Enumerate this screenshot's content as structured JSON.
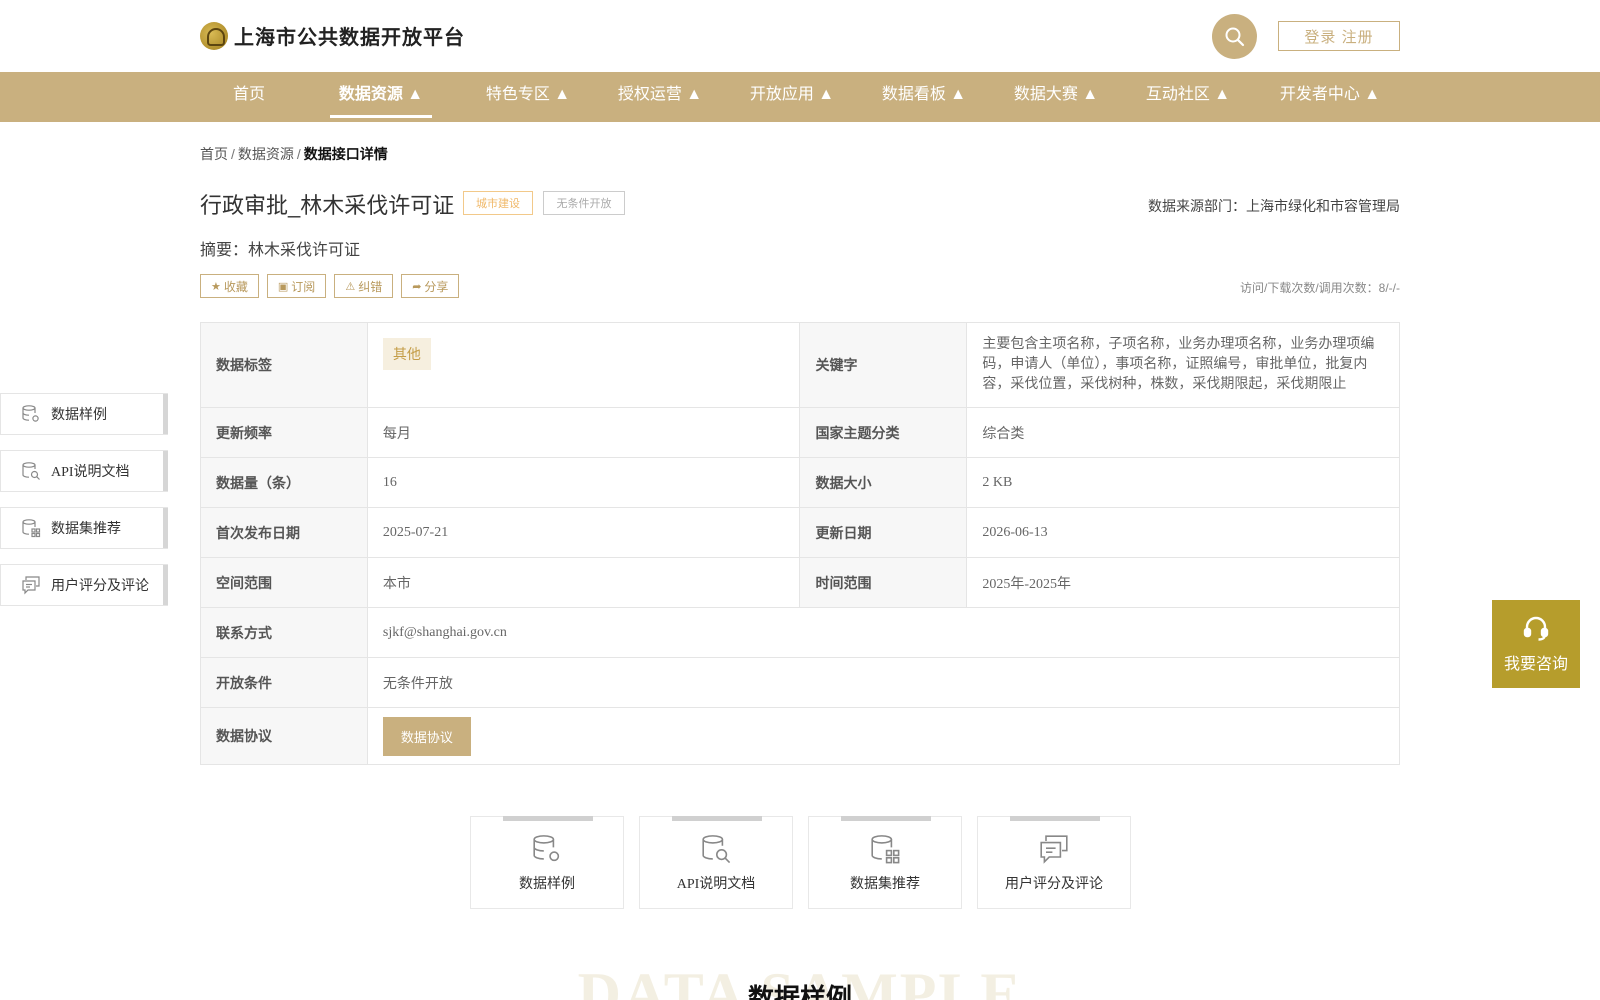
{
  "header": {
    "site_title": "上海市公共数据开放平台",
    "login_label": "登录 注册"
  },
  "nav": {
    "items": [
      {
        "label": "首页"
      },
      {
        "label": "数据资源 ▲"
      },
      {
        "label": "特色专区 ▲"
      },
      {
        "label": "授权运营 ▲"
      },
      {
        "label": "开放应用 ▲"
      },
      {
        "label": "数据看板 ▲"
      },
      {
        "label": "数据大赛 ▲"
      },
      {
        "label": "互动社区 ▲"
      },
      {
        "label": "开发者中心 ▲"
      }
    ],
    "active_index": 1
  },
  "breadcrumb": {
    "items": [
      "首页",
      "数据资源"
    ],
    "current": "数据接口详情",
    "separator": "/"
  },
  "detail": {
    "title": "行政审批_林木采伐许可证",
    "tag_category": "城市建设",
    "tag_open": "无条件开放",
    "source": "数据来源部门：上海市绿化和市容管理局",
    "summary": "摘要：林木采伐许可证",
    "visits": "访问/下载次数/调用次数：8/-/-",
    "actions": {
      "favorite": "收藏",
      "subscribe": "订阅",
      "correct": "纠错",
      "share": "分享"
    }
  },
  "table": {
    "data_tag_label": "数据标签",
    "data_tag_value": "其他",
    "keywords_label": "关键字",
    "keywords_value": "主要包含主项名称，子项名称，业务办理项名称，业务办理项编码，申请人（单位），事项名称，证照编号，审批单位，批复内容，采伐位置，采伐树种，株数，采伐期限起，采伐期限止",
    "freq_label": "更新频率",
    "freq_value": "每月",
    "theme_label": "国家主题分类",
    "theme_value": "综合类",
    "count_label": "数据量（条）",
    "count_value": "16",
    "size_label": "数据大小",
    "size_value": "2 KB",
    "first_pub_label": "首次发布日期",
    "first_pub_value": "2025-07-21",
    "update_label": "更新日期",
    "update_value": "2026-06-13",
    "space_label": "空间范围",
    "space_value": "本市",
    "time_label": "时间范围",
    "time_value": "2025年-2025年",
    "contact_label": "联系方式",
    "contact_value": "sjkf@shanghai.gov.cn",
    "open_cond_label": "开放条件",
    "open_cond_value": "无条件开放",
    "agreement_label": "数据协议",
    "agreement_button": "数据协议"
  },
  "side_nav": {
    "items": [
      {
        "label": "数据样例",
        "icon": "database-gear-icon"
      },
      {
        "label": "API说明文档",
        "icon": "database-search-icon"
      },
      {
        "label": "数据集推荐",
        "icon": "database-grid-icon"
      },
      {
        "label": "用户评分及评论",
        "icon": "chat-icon"
      }
    ]
  },
  "consult": {
    "label": "我要咨询"
  },
  "cards": {
    "items": [
      {
        "label": "数据样例"
      },
      {
        "label": "API说明文档"
      },
      {
        "label": "数据集推荐"
      },
      {
        "label": "用户评分及评论"
      }
    ]
  },
  "section": {
    "bg_text": "DATA SAMPLE",
    "title": "数据样例"
  },
  "colors": {
    "brand": "#c9b07f",
    "consult": "#b69d2c",
    "tag_category": "#f0b868"
  }
}
